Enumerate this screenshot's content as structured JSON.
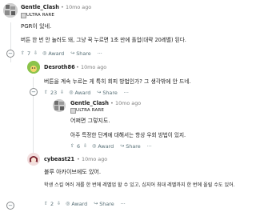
{
  "comments": [
    {
      "author": "Gentle_Clash",
      "time": "10mo ago",
      "flair": "ULTRA RARE",
      "lines": [
        "PGR이 있네.",
        "버튼 한 번 안 눌러도 돼, 그냥 꾹 누르면 1초 만에 풀업(대략 20레벨) 된다."
      ],
      "votes": "7",
      "award": "Award",
      "share": "Share",
      "more": "···"
    },
    {
      "author": "Desroth86",
      "time": "10mo ago",
      "lines": [
        "버튼을 계속 누르는 게 특히 회피 방법인가? 그 생각밖에 안 드네."
      ],
      "votes": "23",
      "award": "Award",
      "share": "Share",
      "more": "···"
    },
    {
      "author": "Gentle_Clash",
      "time": "10mo ago",
      "flair": "ULTRA RARE",
      "lines": [
        "어쩌면 그렇지도.",
        "아주 특정한 단계에 대해서는 항상 우회 방법이 있지."
      ],
      "votes": "6",
      "award": "Award",
      "share": "Share",
      "more": "···"
    },
    {
      "author": "cybeast21",
      "time": "10mo ago",
      "lines": [
        "블루 아카이브에도 있어.",
        "학생 스킬 여러 개를 한 번에 레벨업 할 수 있고, 심지어 최대 레벨까지 한 번에 올릴 수도 있어."
      ],
      "votes": "2",
      "award": "Award",
      "share": "Share",
      "more": "···"
    }
  ],
  "icons": {
    "upvote": "upvote-icon",
    "downvote": "downvote-icon",
    "award": "award-icon",
    "share": "share-icon",
    "collapse": "collapse-icon"
  }
}
